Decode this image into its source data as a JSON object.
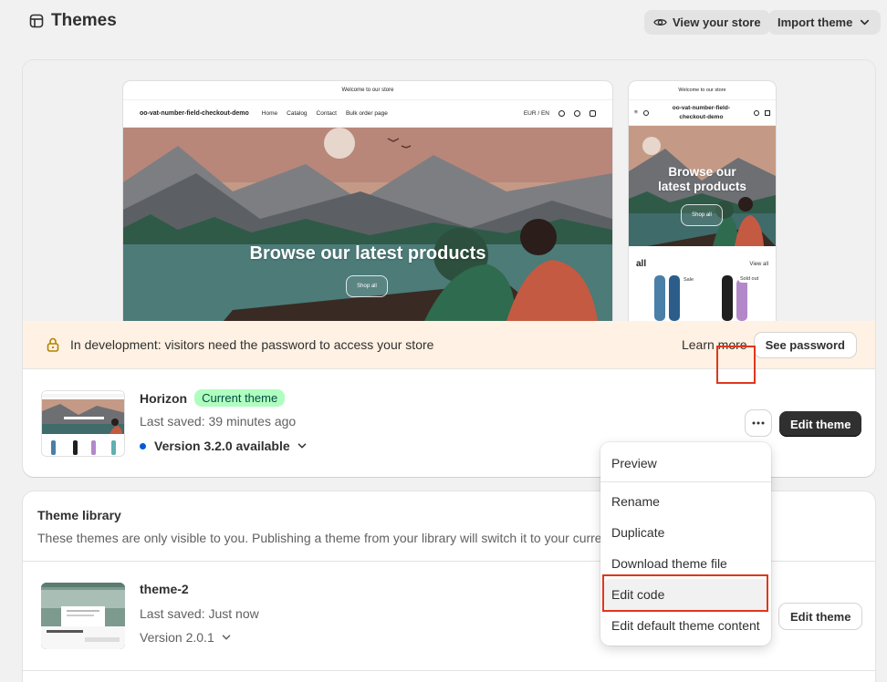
{
  "header": {
    "title": "Themes",
    "view_store_label": "View your store",
    "import_label": "Import theme"
  },
  "preview": {
    "announcement": "Welcome to our store",
    "brand": "oo-vat-number-field-checkout-demo",
    "mobile_brand_line1": "oo-vat-number-field-",
    "mobile_brand_line2": "checkout-demo",
    "nav_items": [
      "Home",
      "Catalog",
      "Contact",
      "Bulk order page"
    ],
    "locale": "EUR / EN",
    "hero_title": "Browse our latest products",
    "mobile_hero_line1": "Browse our",
    "mobile_hero_line2": "latest products",
    "shop_all": "Shop all",
    "mobile_collection": "all",
    "mobile_view_all": "View all",
    "sale_badge": "Sale",
    "soldout_badge": "Sold out"
  },
  "banner": {
    "text": "In development: visitors need the password to access your store",
    "learn_more": "Learn more",
    "see_password": "See password"
  },
  "current_theme": {
    "name": "Horizon",
    "badge": "Current theme",
    "last_saved": "Last saved: 39 minutes ago",
    "version": "Version 3.2.0 available",
    "edit_label": "Edit theme"
  },
  "menu": {
    "items": [
      "Preview",
      "Rename",
      "Duplicate",
      "Download theme file",
      "Edit code",
      "Edit default theme content"
    ]
  },
  "library": {
    "title": "Theme library",
    "description": "These themes are only visible to you. Publishing a theme from your library will switch it to your curre",
    "theme": {
      "name": "theme-2",
      "last_saved": "Last saved: Just now",
      "version": "Version 2.0.1",
      "edit_label": "Edit theme"
    }
  },
  "colors": {
    "accent_red": "#e0361c",
    "badge_green": "#affebf",
    "version_dot": "#005bd3",
    "banner_bg": "#fff1e3"
  }
}
